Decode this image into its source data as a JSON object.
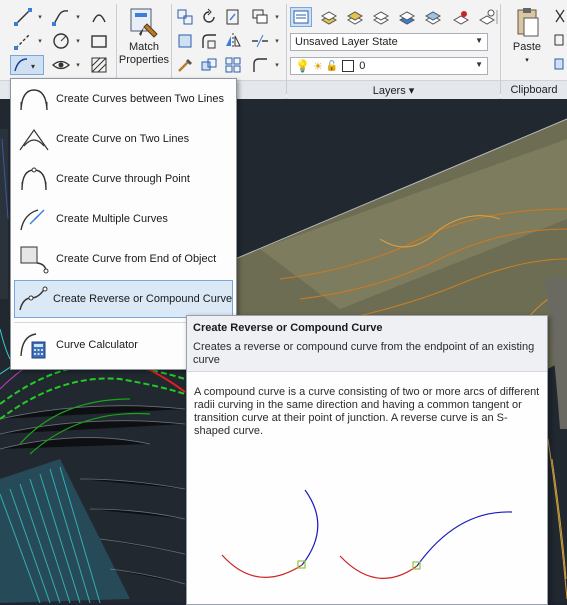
{
  "ribbon": {
    "match_properties_label": "Match\nProperties",
    "layer_state_value": "Unsaved Layer State",
    "layer_value": "0",
    "layers_panel_title": "Layers ▾",
    "paste_label": "Paste",
    "clipboard_panel_title": "Clipboard"
  },
  "curve_menu": {
    "items": [
      {
        "label": "Create Curves between Two Lines",
        "icon": "curve-between-lines-icon"
      },
      {
        "label": "Create Curve on Two Lines",
        "icon": "curve-on-two-lines-icon"
      },
      {
        "label": "Create Curve through Point",
        "icon": "curve-through-point-icon"
      },
      {
        "label": "Create Multiple Curves",
        "icon": "multiple-curves-icon"
      },
      {
        "label": "Create Curve from End of Object",
        "icon": "curve-from-end-icon"
      },
      {
        "label": "Create Reverse or Compound Curve",
        "icon": "reverse-compound-curve-icon"
      },
      {
        "label": "Curve Calculator",
        "icon": "curve-calculator-icon"
      }
    ],
    "selected_index": 5
  },
  "tooltip": {
    "title": "Create Reverse or Compound Curve",
    "short_description": "Creates a reverse or compound curve from the endpoint of an existing curve",
    "long_description": "A compound curve is a curve consisting of two or more arcs of different radii curving in the same direction and having a common tangent or transition curve at their point of junction. A reverse curve is an S-shaped curve.",
    "illustration_colors": {
      "first_arc": "#cc2222",
      "second_arc": "#1a1abf",
      "junction": "#8dc63f"
    }
  }
}
